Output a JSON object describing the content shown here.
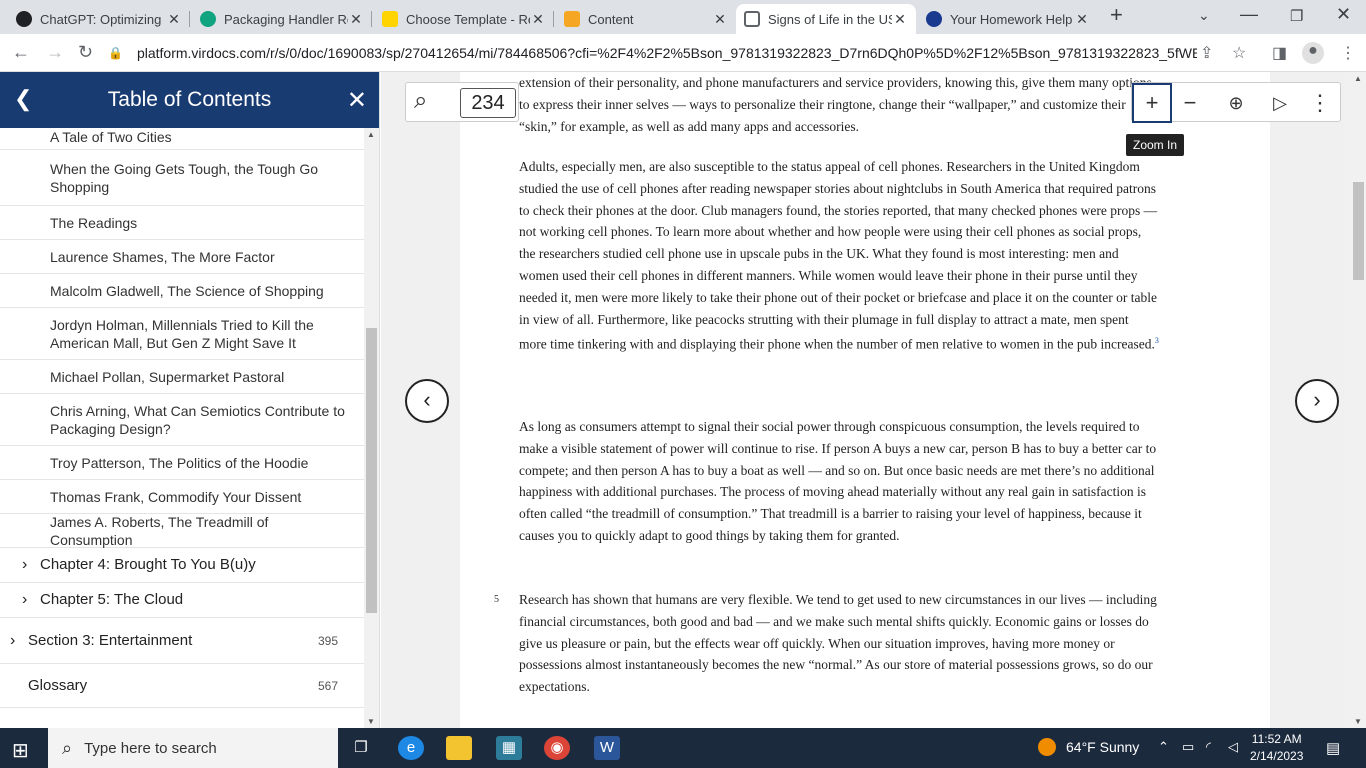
{
  "browser": {
    "tabs": [
      {
        "title": "ChatGPT: Optimizing L",
        "color": "#202124"
      },
      {
        "title": "Packaging Handler Re",
        "color": "#10a37f"
      },
      {
        "title": "Choose Template - Re",
        "color": "#ffd400"
      },
      {
        "title": "Content",
        "color": "#f5a623"
      },
      {
        "title": "Signs of Life in the US",
        "color": "#5f6368"
      },
      {
        "title": "Your Homework Help",
        "color": "#1a3a8f"
      }
    ],
    "url": "platform.virdocs.com/r/s/0/doc/1690083/sp/270412654/mi/784468506?cfi=%2F4%2F2%5Bson_9781319322823_D7rn6DQh0P%5D%2F12%5Bson_9781319322823_5fWE..."
  },
  "sidebar": {
    "title": "Table of Contents",
    "items": [
      {
        "label": "A Tale of Two Cities"
      },
      {
        "label": "When the Going Gets Tough, the Tough Go Shopping"
      },
      {
        "label": "The Readings"
      },
      {
        "label": "Laurence Shames, The More Factor"
      },
      {
        "label": "Malcolm Gladwell, The Science of Shopping"
      },
      {
        "label": "Jordyn Holman, Millennials Tried to Kill the American Mall, But Gen Z Might Save It"
      },
      {
        "label": "Michael Pollan, Supermarket Pastoral"
      },
      {
        "label": "Chris Arning, What Can Semiotics Contribute to Packaging Design?"
      },
      {
        "label": "Troy Patterson, The Politics of the Hoodie"
      },
      {
        "label": "Thomas Frank, Commodify Your Dissent"
      },
      {
        "label": "James A. Roberts, The Treadmill of Consumption"
      }
    ],
    "chapters": [
      {
        "label": "Chapter 4: Brought To You B(u)y"
      },
      {
        "label": "Chapter 5: The Cloud"
      }
    ],
    "section": {
      "label": "Section 3: Entertainment",
      "page": "395"
    },
    "glossary": {
      "label": "Glossary",
      "page": "567"
    }
  },
  "reader": {
    "page_number": "234",
    "tooltip": "Zoom In",
    "paragraphs": [
      "extension of their personality, and phone manufacturers and service providers, knowing this, give them many options to express their inner selves — ways to personalize their ringtone, change their “wallpaper,” and customize their “skin,” for example, as well as add many apps and accessories.",
      "Adults, especially men, are also susceptible to the status appeal of cell phones. Researchers in the United Kingdom studied the use of cell phones after reading newspaper stories about nightclubs in South America that required patrons to check their phones at the door. Club managers found, the stories reported, that many checked phones were props — not working cell phones. To learn more about whether and how people were using their cell phones as social props, the researchers studied cell phone use in upscale pubs in the UK. What they found is most interesting: men and women used their cell phones in different manners. While women would leave their phone in their purse until they needed it, men were more likely to take their phone out of their pocket or briefcase and place it on the counter or table in view of all. Furthermore, like peacocks strutting with their plumage in full display to attract a mate, men spent more time tinkering with and displaying their phone when the number of men relative to women in the pub increased.",
      "As long as consumers attempt to signal their social power through conspicuous consumption, the levels required to make a visible statement of power will continue to rise. If person A buys a new car, person B has to buy a better car to compete; and then person A has to buy a boat as well — and so on. But once basic needs are met there’s no additional happiness with additional purchases. The process of moving ahead materially without any real gain in satisfaction is often called “the treadmill of consumption.” That treadmill is a barrier to raising your level of happiness, because it causes you to quickly adapt to good things by taking them for granted.",
      "Research has shown that humans are very flexible. We tend to get used to new circumstances in our lives — including financial circumstances, both good and bad — and we make such mental shifts quickly. Economic gains or losses do give us pleasure or pain, but the effects wear off quickly. When our situation improves, having more money or possessions almost instantaneously becomes the new “normal.” As our store of material possessions grows, so do our expectations."
    ],
    "footnote": "3",
    "paragraph_number": "5"
  },
  "taskbar": {
    "search_placeholder": "Type here to search",
    "weather": "64°F  Sunny",
    "time": "11:52 AM",
    "date": "2/14/2023"
  }
}
